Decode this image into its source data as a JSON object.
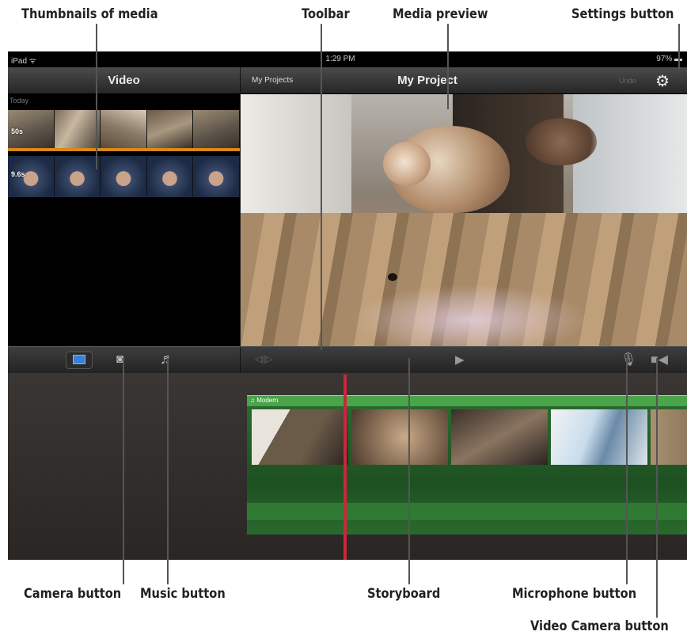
{
  "annotations": {
    "thumbnails": "Thumbnails of media",
    "toolbar": "Toolbar",
    "media_preview": "Media preview",
    "settings": "Settings button",
    "camera": "Camera button",
    "music": "Music button",
    "storyboard": "Storyboard",
    "microphone": "Microphone button",
    "video_camera": "Video Camera button"
  },
  "status_bar": {
    "carrier": "iPad ᯤ",
    "time": "1:29 PM",
    "battery": "97% ▬"
  },
  "nav": {
    "left_title": "Video",
    "projects_button": "My Projects",
    "title": "My Project",
    "undo": "Undo",
    "settings_icon": "⚙"
  },
  "browser": {
    "section": "Today",
    "clips": [
      {
        "duration": "50s"
      },
      {
        "duration": "9.6s"
      }
    ]
  },
  "toolbar": {
    "video_icon": "video-browser-icon",
    "camera_icon": "◙",
    "music_icon": "♬",
    "audio_icon": "◁||▷",
    "play_icon": "▶",
    "mic_icon": "🎙",
    "video_camera_icon": "■◀"
  },
  "timeline": {
    "music_track_label": "♫ Modern"
  },
  "colors": {
    "playhead": "#c8283c",
    "music_track": "#4aa44a",
    "selected_border": "#d88a1a"
  }
}
